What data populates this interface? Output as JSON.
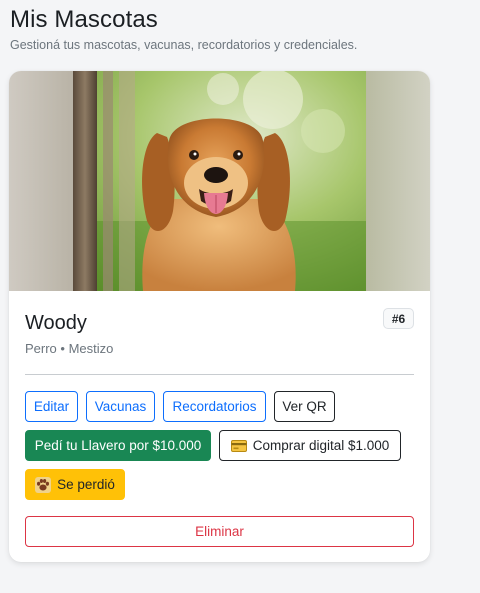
{
  "header": {
    "title": "Mis Mascotas",
    "subtitle": "Gestioná tus mascotas, vacunas, recordatorios y credenciales."
  },
  "pet": {
    "name": "Woody",
    "meta": "Perro • Mestizo",
    "id_badge": "#6",
    "photo_subject": "golden retriever dog"
  },
  "actions": {
    "edit": "Editar",
    "vaccines": "Vacunas",
    "reminders": "Recordatorios",
    "qr": "Ver QR",
    "order_keychain": "Pedí tu Llavero por $10.000",
    "buy_digital": "Comprar digital $1.000",
    "lost": "Se perdió",
    "delete": "Eliminar"
  },
  "icons": {
    "buy_digital": "credit-card-icon",
    "lost": "paw-icon"
  },
  "colors": {
    "primary": "#0d6efd",
    "success": "#198754",
    "warning": "#ffc107",
    "danger": "#dc3545",
    "dark": "#212529",
    "muted": "#6c757d"
  }
}
